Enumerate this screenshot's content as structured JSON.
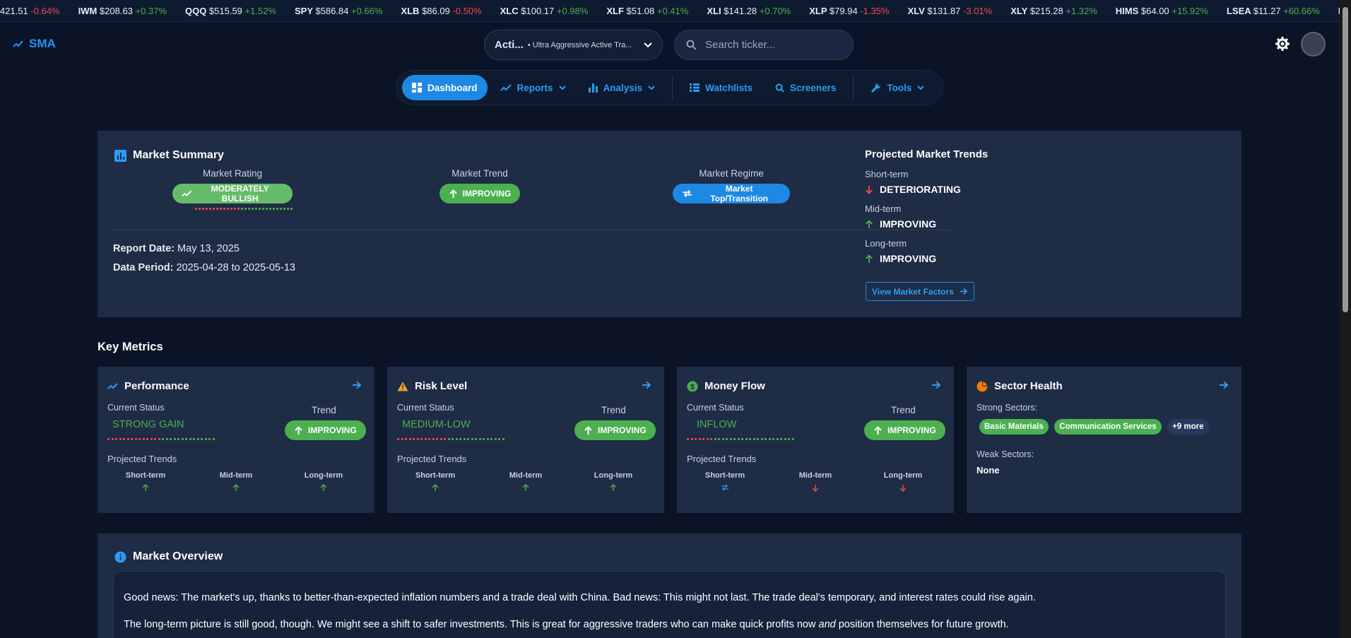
{
  "ticker": [
    {
      "sym": "",
      "px": "421.51",
      "chg": "-0.64%",
      "dir": "neg"
    },
    {
      "sym": "IWM",
      "px": "$208.63",
      "chg": "+0.37%",
      "dir": "pos"
    },
    {
      "sym": "QQQ",
      "px": "$515.59",
      "chg": "+1.52%",
      "dir": "pos"
    },
    {
      "sym": "SPY",
      "px": "$586.84",
      "chg": "+0.66%",
      "dir": "pos"
    },
    {
      "sym": "XLB",
      "px": "$86.09",
      "chg": "-0.50%",
      "dir": "neg"
    },
    {
      "sym": "XLC",
      "px": "$100.17",
      "chg": "+0.98%",
      "dir": "pos"
    },
    {
      "sym": "XLF",
      "px": "$51.08",
      "chg": "+0.41%",
      "dir": "pos"
    },
    {
      "sym": "XLI",
      "px": "$141.28",
      "chg": "+0.70%",
      "dir": "pos"
    },
    {
      "sym": "XLP",
      "px": "$79.94",
      "chg": "-1.35%",
      "dir": "neg"
    },
    {
      "sym": "XLV",
      "px": "$131.87",
      "chg": "-3.01%",
      "dir": "neg"
    },
    {
      "sym": "XLY",
      "px": "$215.28",
      "chg": "+1.32%",
      "dir": "pos"
    },
    {
      "sym": "HIMS",
      "px": "$64.00",
      "chg": "+15.92%",
      "dir": "pos"
    },
    {
      "sym": "LSEA",
      "px": "$11.27",
      "chg": "+60.66%",
      "dir": "pos"
    },
    {
      "sym": "M",
      "px": "",
      "chg": "",
      "dir": "pos"
    }
  ],
  "header": {
    "logo": "SMA",
    "account_name": "Acti...",
    "account_desc": "• Ultra Aggressive Active Tra...",
    "search_placeholder": "Search ticker..."
  },
  "nav": {
    "dashboard": "Dashboard",
    "reports": "Reports",
    "analysis": "Analysis",
    "watchlists": "Watchlists",
    "screeners": "Screeners",
    "tools": "Tools"
  },
  "summary": {
    "title": "Market Summary",
    "rating_label": "Market Rating",
    "rating_value": "MODERATELY BULLISH",
    "trend_label": "Market Trend",
    "trend_value": "IMPROVING",
    "regime_label": "Market Regime",
    "regime_value": "Market Top/Transition",
    "report_date_label": "Report Date:",
    "report_date": "May 13, 2025",
    "data_period_label": "Data Period:",
    "data_period": "2025-04-28 to 2025-05-13",
    "projected_title": "Projected Market Trends",
    "short_label": "Short-term",
    "short_value": "DETERIORATING",
    "mid_label": "Mid-term",
    "mid_value": "IMPROVING",
    "long_label": "Long-term",
    "long_value": "IMPROVING",
    "view_factors": "View Market Factors"
  },
  "key_metrics_title": "Key Metrics",
  "metrics": {
    "performance": {
      "title": "Performance",
      "status_label": "Current Status",
      "status": "STRONG GAIN",
      "trend_label": "Trend",
      "trend": "IMPROVING",
      "pt_label": "Projected Trends",
      "short": "Short-term",
      "mid": "Mid-term",
      "long": "Long-term"
    },
    "risk": {
      "title": "Risk Level",
      "status_label": "Current Status",
      "status": "MEDIUM-LOW",
      "trend_label": "Trend",
      "trend": "IMPROVING",
      "pt_label": "Projected Trends",
      "short": "Short-term",
      "mid": "Mid-term",
      "long": "Long-term"
    },
    "money": {
      "title": "Money Flow",
      "status_label": "Current Status",
      "status": "INFLOW",
      "trend_label": "Trend",
      "trend": "IMPROVING",
      "pt_label": "Projected Trends",
      "short": "Short-term",
      "mid": "Mid-term",
      "long": "Long-term"
    },
    "sector": {
      "title": "Sector Health",
      "strong_label": "Strong Sectors:",
      "strong_1": "Basic Materials",
      "strong_2": "Communication Services",
      "more": "+9 more",
      "weak_label": "Weak Sectors:",
      "weak_value": "None"
    }
  },
  "overview": {
    "title": "Market Overview",
    "p1": "Good news: The market's up, thanks to better-than-expected inflation numbers and a trade deal with China. Bad news: This might not last. The trade deal's temporary, and interest rates could rise again.",
    "p2_a": "The long-term picture is still good, though. We might see a shift to safer investments. This is great for aggressive traders who can make quick profits now ",
    "p2_em": "and",
    "p2_b": " position themselves for future growth."
  },
  "colors": {
    "accent": "#1e88e5",
    "positive": "#4caf50",
    "negative": "#ef4b4b",
    "card": "#1e2c45",
    "background": "#0b1426"
  }
}
